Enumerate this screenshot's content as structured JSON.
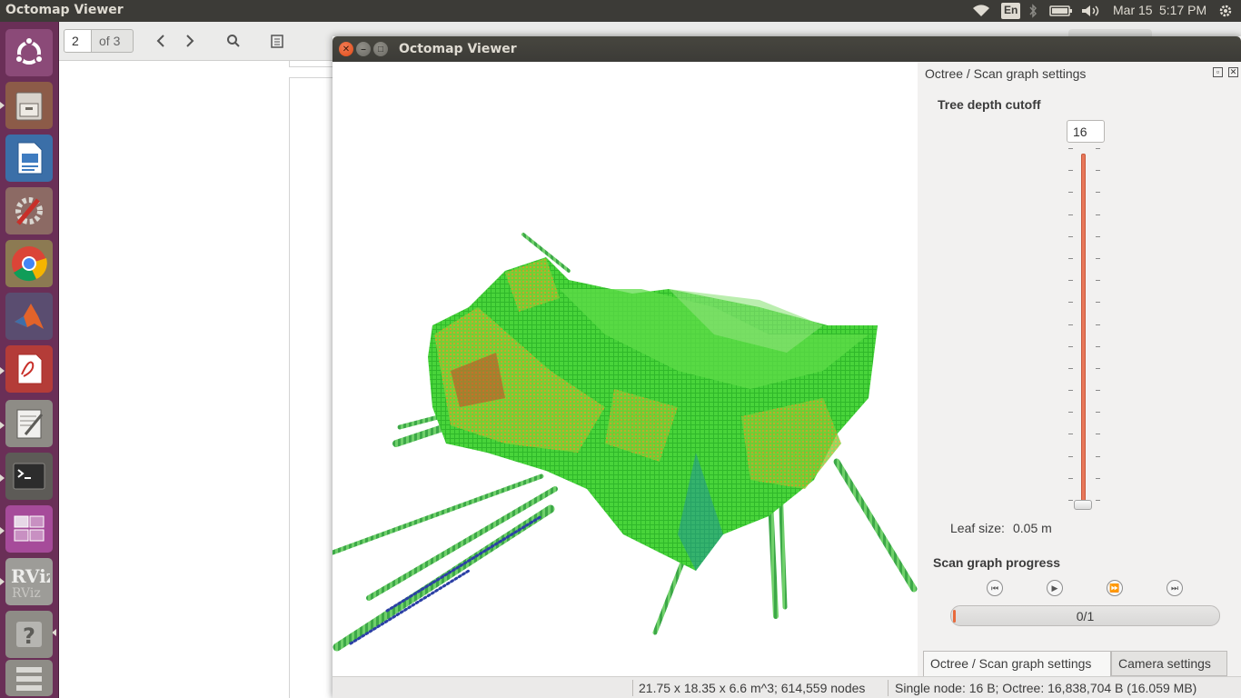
{
  "top_panel": {
    "title": "Octomap Viewer",
    "language": "En",
    "date": "Mar 15",
    "time": "5:17 PM"
  },
  "launcher": {
    "items": [
      "ubuntu-dash",
      "files",
      "libreoffice-writer",
      "system-settings",
      "chrome",
      "matlab",
      "pdf-viewer",
      "text-editor",
      "terminal",
      "workspace-switcher",
      "rviz",
      "help",
      "trash"
    ]
  },
  "doc_viewer": {
    "page_number": "2",
    "page_of": "of 3"
  },
  "window": {
    "title": "Octomap Viewer"
  },
  "dock": {
    "title": "Octree / Scan graph settings",
    "depth_label": "Tree depth cutoff",
    "depth_value": "16",
    "depth_max": 16,
    "leaf_label": "Leaf size:",
    "leaf_value": "0.05 m",
    "scan_label": "Scan graph progress",
    "progress_text": "0/1",
    "progress_fraction": 0
  },
  "tabs": {
    "octree": "Octree / Scan graph settings",
    "camera": "Camera settings"
  },
  "statusbar": {
    "volume": "21.75 x 18.35 x 6.6 m^3; 614,559 nodes",
    "memory": "Single node: 16 B; Octree: 16,838,704 B (16.059 MB)"
  },
  "colors": {
    "accent": "#e8785a",
    "panel": "#3c3b37",
    "launcher": "#6a2f57"
  }
}
